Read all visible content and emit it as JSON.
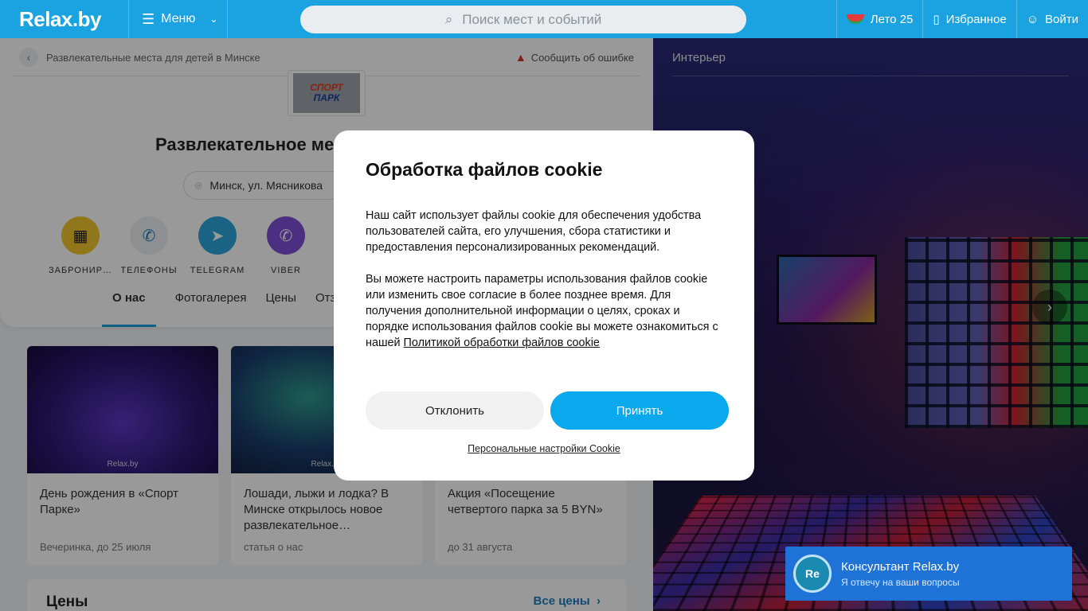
{
  "header": {
    "logo": "Relax.by",
    "menu_label": "Меню",
    "search_placeholder": "Поиск мест и событий",
    "season_label": "Лето 25",
    "favorites_label": "Избранное",
    "login_label": "Войти"
  },
  "breadcrumb": {
    "label": "Развлекательные места для детей в Минске"
  },
  "report_error": "Сообщить об ошибке",
  "place": {
    "logo_line1": "СПОРТ",
    "logo_line2": "ПАРК",
    "title": "Развлекательное ме",
    "address": "Минск, ул. Мясникова"
  },
  "actions": [
    {
      "label": "ЗАБРОНИР…",
      "icon": "calendar-icon"
    },
    {
      "label": "ТЕЛЕФОНЫ",
      "icon": "phone-icon"
    },
    {
      "label": "TELEGRAM",
      "icon": "telegram-icon"
    },
    {
      "label": "VIBER",
      "icon": "viber-icon"
    }
  ],
  "tabs": [
    "О нас",
    "Фотогалерея",
    "Цены",
    "Отзы"
  ],
  "tiles": [
    {
      "title": "День рождения в «Спорт Парке»",
      "meta": "Вечеринка, до 25 июля",
      "watermark": "Relax.by"
    },
    {
      "title": "Лошади, лыжи и лодка? В Минске открылось новое развлекательное…",
      "meta": "статья о нас",
      "watermark": "Relax.by"
    },
    {
      "title": "Акция «Посещение четвертого парка за 5 BYN»",
      "meta": "до 31 августа"
    }
  ],
  "prices": {
    "heading": "Цены",
    "all_link": "Все цены"
  },
  "photo": {
    "label": "Интерьер"
  },
  "consultant": {
    "avatar": "Re",
    "title": "Консультант Relax.by",
    "subtitle": "Я отвечу на ваши вопросы"
  },
  "cookie_modal": {
    "title": "Обработка файлов cookie",
    "text1": "Наш сайт использует файлы cookie для обеспечения удобства пользователей сайта, его улучшения, сбора статистики и предоставления персонализированных рекомендаций.",
    "text2": "Вы можете настроить параметры использования файлов cookie или изменить свое согласие в более позднее время. Для получения дополнительной информации о целях, сроках и порядке использования файлов cookie вы можете ознакомиться с нашей",
    "policy_link": "Политикой обработки файлов cookie",
    "decline": "Отклонить",
    "accept": "Принять",
    "settings_link": "Персональные настройки Cookie"
  },
  "colors": {
    "brand": "#1aa3e0",
    "accept": "#0aa8ec",
    "consultant": "#1f73d6"
  }
}
